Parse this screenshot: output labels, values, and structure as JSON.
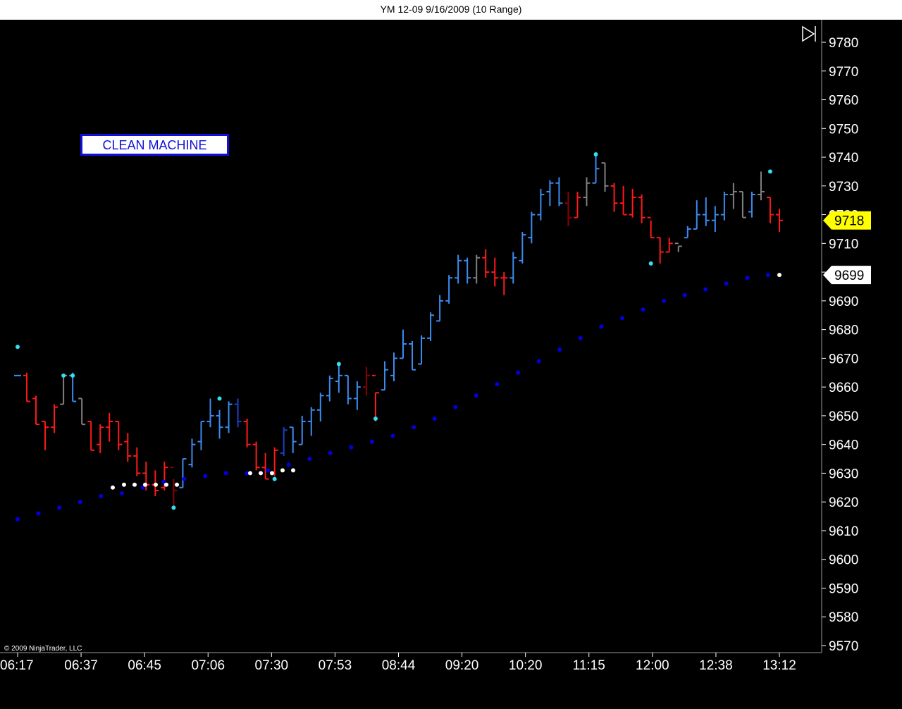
{
  "window": {
    "title": "YM 12-09  9/16/2009 (10 Range)"
  },
  "overlay": {
    "label": "CLEAN MACHINE",
    "copyright": "© 2009 NinjaTrader, LLC"
  },
  "colors": {
    "background": "#000000",
    "up_bar": "#3b8cf0",
    "down_bar": "#ff1a1a",
    "dark_down_bar": "#8b0000",
    "dark_up_bar": "#1a3fc8",
    "neutral_bar": "#808080",
    "pivot_dot": "#33e0f0",
    "trail_dot": "#0000e0",
    "trail_dot_active": "#ffffff",
    "last_price_bg": "#ffff00"
  },
  "icons": {
    "scroll_end": "skip-to-end-icon"
  },
  "chart_data": {
    "type": "ohlc",
    "title": "YM 12-09  9/16/2009 (10 Range)",
    "y_ticks": [
      9570,
      9580,
      9590,
      9600,
      9610,
      9620,
      9630,
      9640,
      9650,
      9660,
      9670,
      9680,
      9690,
      9700,
      9710,
      9720,
      9730,
      9740,
      9750,
      9760,
      9770,
      9780
    ],
    "ylim": [
      9567,
      9784
    ],
    "x_ticks": [
      "06:17",
      "06:37",
      "06:45",
      "07:06",
      "07:30",
      "07:53",
      "08:44",
      "09:20",
      "10:20",
      "11:15",
      "12:00",
      "12:38",
      "13:12"
    ],
    "grid": false,
    "last_price": "9718",
    "indicator_value": "9699",
    "bars": [
      [
        9664,
        9674,
        9674,
        9664,
        "up"
      ],
      [
        9664,
        9665,
        9655,
        9655,
        "down"
      ],
      [
        9656,
        9657,
        9647,
        9647,
        "down"
      ],
      [
        9648,
        9648,
        9638,
        9646,
        "down"
      ],
      [
        9646,
        9654,
        9644,
        9653,
        "down"
      ],
      [
        9654,
        9664,
        9654,
        9664,
        "neutral"
      ],
      [
        9664,
        9665,
        9655,
        9655,
        "up"
      ],
      [
        9656,
        9656,
        9647,
        9647,
        "neutral"
      ],
      [
        9648,
        9648,
        9638,
        9638,
        "down"
      ],
      [
        9640,
        9647,
        9637,
        9646,
        "down"
      ],
      [
        9646,
        9651,
        9641,
        9648,
        "down"
      ],
      [
        9648,
        9648,
        9638,
        9640,
        "down"
      ],
      [
        9641,
        9644,
        9634,
        9636,
        "down"
      ],
      [
        9636,
        9639,
        9629,
        9630,
        "down"
      ],
      [
        9630,
        9634,
        9624,
        9626,
        "down"
      ],
      [
        9626,
        9631,
        9622,
        9624,
        "down"
      ],
      [
        9625,
        9634,
        9624,
        9632,
        "down"
      ],
      [
        9632,
        9628,
        9618,
        9624,
        "dark_down"
      ],
      [
        9625,
        9635,
        9625,
        9635,
        "up"
      ],
      [
        9633,
        9642,
        9632,
        9640,
        "up"
      ],
      [
        9641,
        9648,
        9638,
        9648,
        "up"
      ],
      [
        9648,
        9656,
        9646,
        9650,
        "up"
      ],
      [
        9650,
        9652,
        9642,
        9646,
        "up"
      ],
      [
        9646,
        9655,
        9644,
        9654,
        "up"
      ],
      [
        9654,
        9656,
        9646,
        9648,
        "dark_up"
      ],
      [
        9648,
        9649,
        9639,
        9640,
        "down"
      ],
      [
        9640,
        9641,
        9631,
        9632,
        "down"
      ],
      [
        9632,
        9637,
        9628,
        9628,
        "down"
      ],
      [
        9630,
        9639,
        9629,
        9638,
        "down"
      ],
      [
        9637,
        9646,
        9636,
        9645,
        "dark_up"
      ],
      [
        9646,
        9646,
        9637,
        9641,
        "up"
      ],
      [
        9640,
        9650,
        9640,
        9648,
        "up"
      ],
      [
        9648,
        9653,
        9643,
        9652,
        "up"
      ],
      [
        9652,
        9658,
        9648,
        9657,
        "up"
      ],
      [
        9657,
        9664,
        9655,
        9663,
        "up"
      ],
      [
        9662,
        9668,
        9658,
        9664,
        "up"
      ],
      [
        9664,
        9664,
        9654,
        9656,
        "up"
      ],
      [
        9656,
        9662,
        9652,
        9660,
        "up"
      ],
      [
        9660,
        9667,
        9657,
        9664,
        "dark_down"
      ],
      [
        9664,
        9658,
        9648,
        9658,
        "down"
      ],
      [
        9659,
        9669,
        9659,
        9666,
        "up"
      ],
      [
        9664,
        9672,
        9662,
        9670,
        "up"
      ],
      [
        9670,
        9680,
        9670,
        9675,
        "up"
      ],
      [
        9675,
        9676,
        9666,
        9666,
        "up"
      ],
      [
        9668,
        9678,
        9668,
        9677,
        "up"
      ],
      [
        9677,
        9686,
        9676,
        9685,
        "up"
      ],
      [
        9683,
        9692,
        9683,
        9690,
        "up"
      ],
      [
        9690,
        9699,
        9689,
        9698,
        "up"
      ],
      [
        9698,
        9706,
        9696,
        9704,
        "up"
      ],
      [
        9704,
        9705,
        9696,
        9698,
        "up"
      ],
      [
        9698,
        9706,
        9696,
        9705,
        "neutral"
      ],
      [
        9705,
        9708,
        9698,
        9700,
        "down"
      ],
      [
        9700,
        9705,
        9695,
        9698,
        "down"
      ],
      [
        9698,
        9700,
        9692,
        9698,
        "down"
      ],
      [
        9698,
        9707,
        9696,
        9705,
        "up"
      ],
      [
        9704,
        9714,
        9703,
        9713,
        "up"
      ],
      [
        9712,
        9721,
        9710,
        9720,
        "up"
      ],
      [
        9720,
        9729,
        9718,
        9727,
        "up"
      ],
      [
        9728,
        9732,
        9723,
        9731,
        "up"
      ],
      [
        9731,
        9733,
        9723,
        9724,
        "up"
      ],
      [
        9724,
        9728,
        9716,
        9719,
        "dark_down"
      ],
      [
        9719,
        9728,
        9719,
        9726,
        "down"
      ],
      [
        9726,
        9733,
        9723,
        9731,
        "neutral"
      ],
      [
        9731,
        9741,
        9731,
        9736,
        "up"
      ],
      [
        9738,
        9738,
        9728,
        9730,
        "neutral"
      ],
      [
        9730,
        9731,
        9721,
        9724,
        "down"
      ],
      [
        9724,
        9730,
        9720,
        9720,
        "down"
      ],
      [
        9720,
        9729,
        9719,
        9726,
        "down"
      ],
      [
        9726,
        9727,
        9717,
        9719,
        "down"
      ],
      [
        9719,
        9718,
        9712,
        9712,
        "down"
      ],
      [
        9712,
        9712,
        9703,
        9707,
        "down"
      ],
      [
        9707,
        9712,
        9707,
        9710,
        "down"
      ],
      [
        9710,
        9707,
        9709,
        9709,
        "neutral"
      ],
      [
        9712,
        9716,
        9712,
        9715,
        "up"
      ],
      [
        9715,
        9725,
        9715,
        9720,
        "up"
      ],
      [
        9720,
        9726,
        9716,
        9718,
        "up"
      ],
      [
        9718,
        9723,
        9714,
        9720,
        "up"
      ],
      [
        9720,
        9728,
        9718,
        9727,
        "up"
      ],
      [
        9727,
        9731,
        9722,
        9728,
        "neutral"
      ],
      [
        9728,
        9728,
        9719,
        9719,
        "neutral"
      ],
      [
        9721,
        9728,
        9719,
        9727,
        "up"
      ],
      [
        9727,
        9735,
        9725,
        9728,
        "neutral"
      ],
      [
        9726,
        9726,
        9717,
        9720,
        "down"
      ],
      [
        9720,
        9722,
        9714,
        9718,
        "down"
      ]
    ],
    "pivots": [
      9674,
      9664,
      9664,
      9618,
      9656,
      9628,
      9668,
      9649,
      9741,
      9703,
      9735
    ],
    "trailing_stop_active": [
      9625,
      9626,
      9626,
      9626,
      9626,
      9626,
      9626,
      9630,
      9630,
      9630,
      9631,
      9631,
      9699
    ],
    "trailing_stop": [
      9614,
      9616,
      9618,
      9620,
      9622,
      9623,
      9625,
      9627,
      9628,
      9629,
      9630,
      9630,
      9631,
      9633,
      9635,
      9637,
      9639,
      9641,
      9643,
      9646,
      9649,
      9653,
      9657,
      9661,
      9665,
      9669,
      9673,
      9677,
      9681,
      9684,
      9687,
      9690,
      9692,
      9694,
      9696,
      9698,
      9699
    ]
  }
}
